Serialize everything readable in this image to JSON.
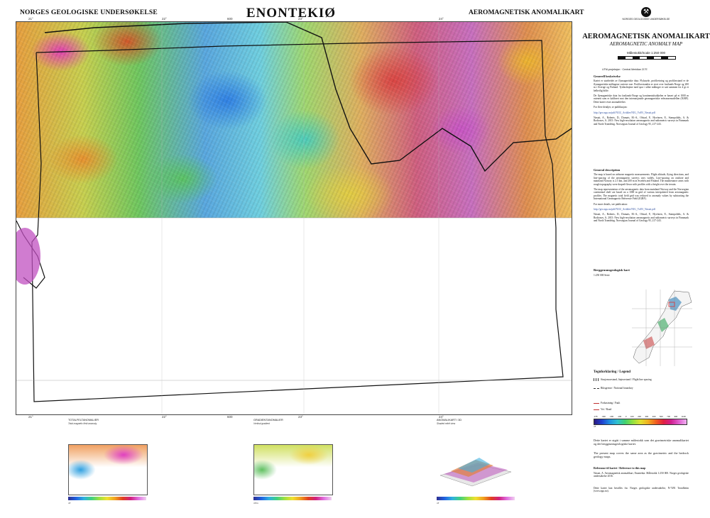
{
  "header": {
    "left": "NORGES GEOLOGISKE UNDERSØKELSE",
    "center": "ENONTEKIØ",
    "right": "AEROMAGNETISK ANOMALIKART"
  },
  "map": {
    "top_ticks": [
      "21°",
      "22°",
      "600",
      "23°",
      "24°"
    ],
    "bottom_ticks": [
      "21°",
      "22°",
      "600",
      "23°",
      "24°"
    ]
  },
  "insets": [
    {
      "title": "TOTALFELTANOMALIER",
      "sub": "Total magnetic field anomaly",
      "unit": "nT"
    },
    {
      "title": "GRADIENTANOMALIER",
      "sub": "Vertical gradient",
      "unit": "nT/m"
    },
    {
      "title": "ANOMALIKART I 3D",
      "sub": "Shaded relief view",
      "unit": "nT"
    }
  ],
  "sidebar": {
    "logo_text": "NORGES GEOLOGISKE UNDERSØKELSE",
    "title": "AEROMAGNETISK ANOMALIKART",
    "subtitle": "AEROMAGNETIC ANOMALY MAP",
    "scale": "Målestokk/Scale 1:250 000",
    "projection": "UTM-projeksjon · Central Meridian 21°E",
    "general_head": "Generell beskrivelse",
    "general_text": "Kartet er utarbeidet av flymagnetiske data. Flyhøyde, profilretning og profilavstand er de flymagnetiske målingene varierer noe. Profilavstanden er stort over fastlands-Norge og 200 m i Sverige og Finland. Tyttlaslinjene med spor i ulike målinger er satt sammen for å gi et helhetlig bilde.",
    "general_text2": "De flymagnetiske data fra fastlands-Norge og kontinentalsokkelen er basert på et 1000 m rutenett som er kalibrert mot den internasjonale geomagnetiske referansemodellen (IGRF). Dette kartet viser anomalifeltet.",
    "pub_line": "For flere detaljer, se publikasjon:",
    "link1": "http://geo.ngu.no/pdf/NGU_Artikler/NJG_Vol91_Nasuti.pdf",
    "ref1": "Nasuti, A., Roberts, D., Dumais, M.-A., Ofstad, F., Hyvönen, E., Stampolidis, A. & Rodionov, A. 2015: New high-resolution aeromagnetic and radiometric surveys in Finnmark and North Trøndelag. Norwegian Journal of Geology 95, 217-243.",
    "english_head": "General description",
    "english_text": "The map is based on airborne magnetic measurements. Flight altitude, flying directions, and line-spacing of the aeromagnetic surveys vary widely. Line-spacing on onshore and mainland Norway is 2.5 km, and 200 m in Sweden and Finland. The maintenance areas with rough topography were draped-flown with profiles with a height over the terrain.",
    "english_text2": "The map representation of the aeromagnetic data from mainland Norway and the Norwegian continental shelf are based on a 1000 m grid of various interpolated from aeromagnetic profiles. The magnetic total field grid was reduced to anomaly values by subtracting the International Geomagnetic Reference Field (IGRF).",
    "pub_line2": "For more details, see publication:",
    "link2": "http://geo.ngu.no/pdf/NGU_Artikler/NJG_Vol91_Nasuti.pdf",
    "ref2": "Nasuti, A., Roberts, D., Dumais, M.-A., Ofstad, F., Hyvönen, E., Stampolidis, A. & Rodionov, A. 2015: New high-resolution aeromagnetic and radiometric surveys in Finnmark and North Trøndelag. Norwegian Journal of Geology 95, 217-243.",
    "geo_head": "Berggrunnsgeologisk kart",
    "geo_sub": "1:250 000 Serie",
    "legend_head": "Tegnforklaring / Legend",
    "legend_items": [
      "Stasjonsavstand, linjeavstand / Flight line spacing",
      "Riksgrense / National boundary",
      "Forkastning / Fault",
      "Vei / Road"
    ],
    "cbar_ticks": [
      "-475",
      "-300",
      "-200",
      "-100",
      "0",
      "100",
      "200",
      "300",
      "400",
      "500",
      "700",
      "900",
      "1100"
    ],
    "cbar_unit": "nT",
    "footer1": "Dette kartet er utgitt i samme målestokk som det gravimetriske anomalikartet og det berggrunnsgeologiske kartet.",
    "footer2": "The present map covers the same area as the gravimetric and the bedrock geology maps.",
    "ref_head": "Referanse til kartet / Reference to this map",
    "ref_map": "Nasuti, A. Aeromagnetisk anomalikart, Enontekiø. Målestokk 1:250 000. Norges geologiske undersøkelse 2016.",
    "contact": "Dette kartet kan bestilles fra: Norges geologiske undersøkelse, N-7491 Trondheim (www.ngu.no)."
  },
  "colors": {
    "border": "#222222",
    "link": "#3050a0"
  }
}
